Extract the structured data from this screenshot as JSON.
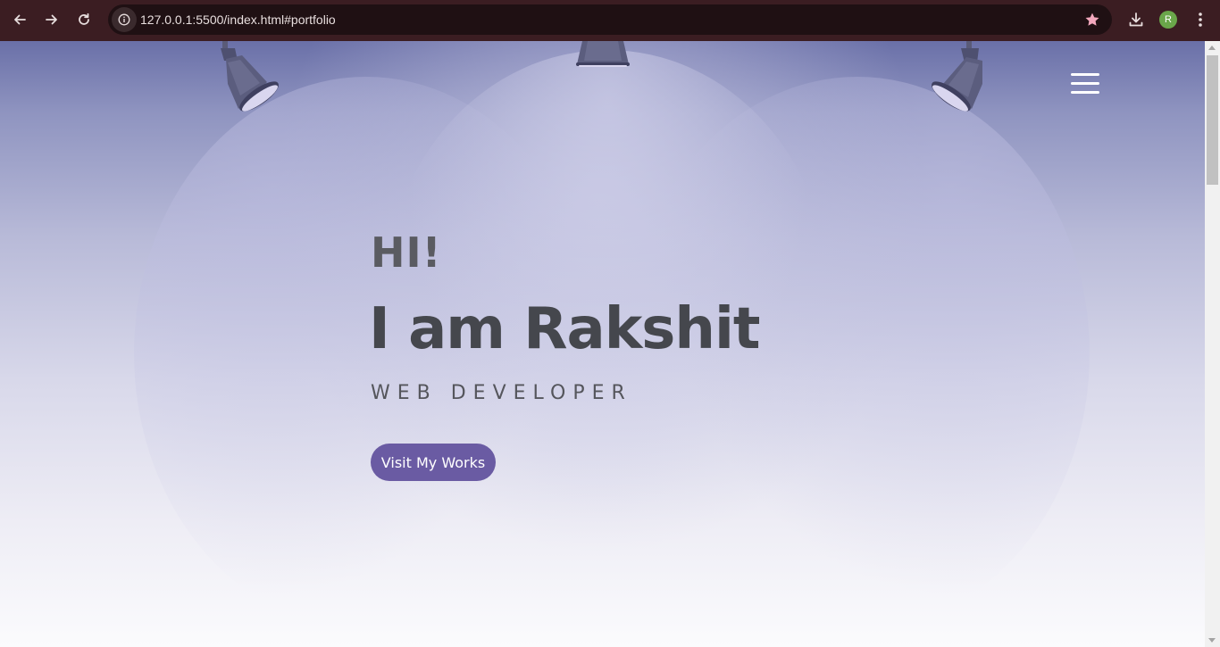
{
  "browser": {
    "url": "127.0.0.1:5500/index.html#portfolio",
    "profile_initial": "R",
    "icons": {
      "back": "arrow-left-icon",
      "forward": "arrow-right-icon",
      "reload": "reload-icon",
      "site_info": "info-icon",
      "bookmark": "star-icon",
      "downloads": "download-icon",
      "menu": "more-vertical-icon"
    },
    "colors": {
      "frame": "#3b1d22",
      "omnibox": "#1f1013",
      "star": "#f3a8bd",
      "avatar": "#6aa64a"
    }
  },
  "page": {
    "nav": {
      "menu_icon": "hamburger-menu-icon"
    },
    "hero": {
      "greeting": "HI!",
      "name": "I am Rakshit",
      "role": "WEB DEVELOPER",
      "cta_label": "Visit My Works"
    },
    "colors": {
      "accent": "#6a5ba3",
      "heading": "#45474d",
      "background_top": "#6a70a8"
    }
  }
}
